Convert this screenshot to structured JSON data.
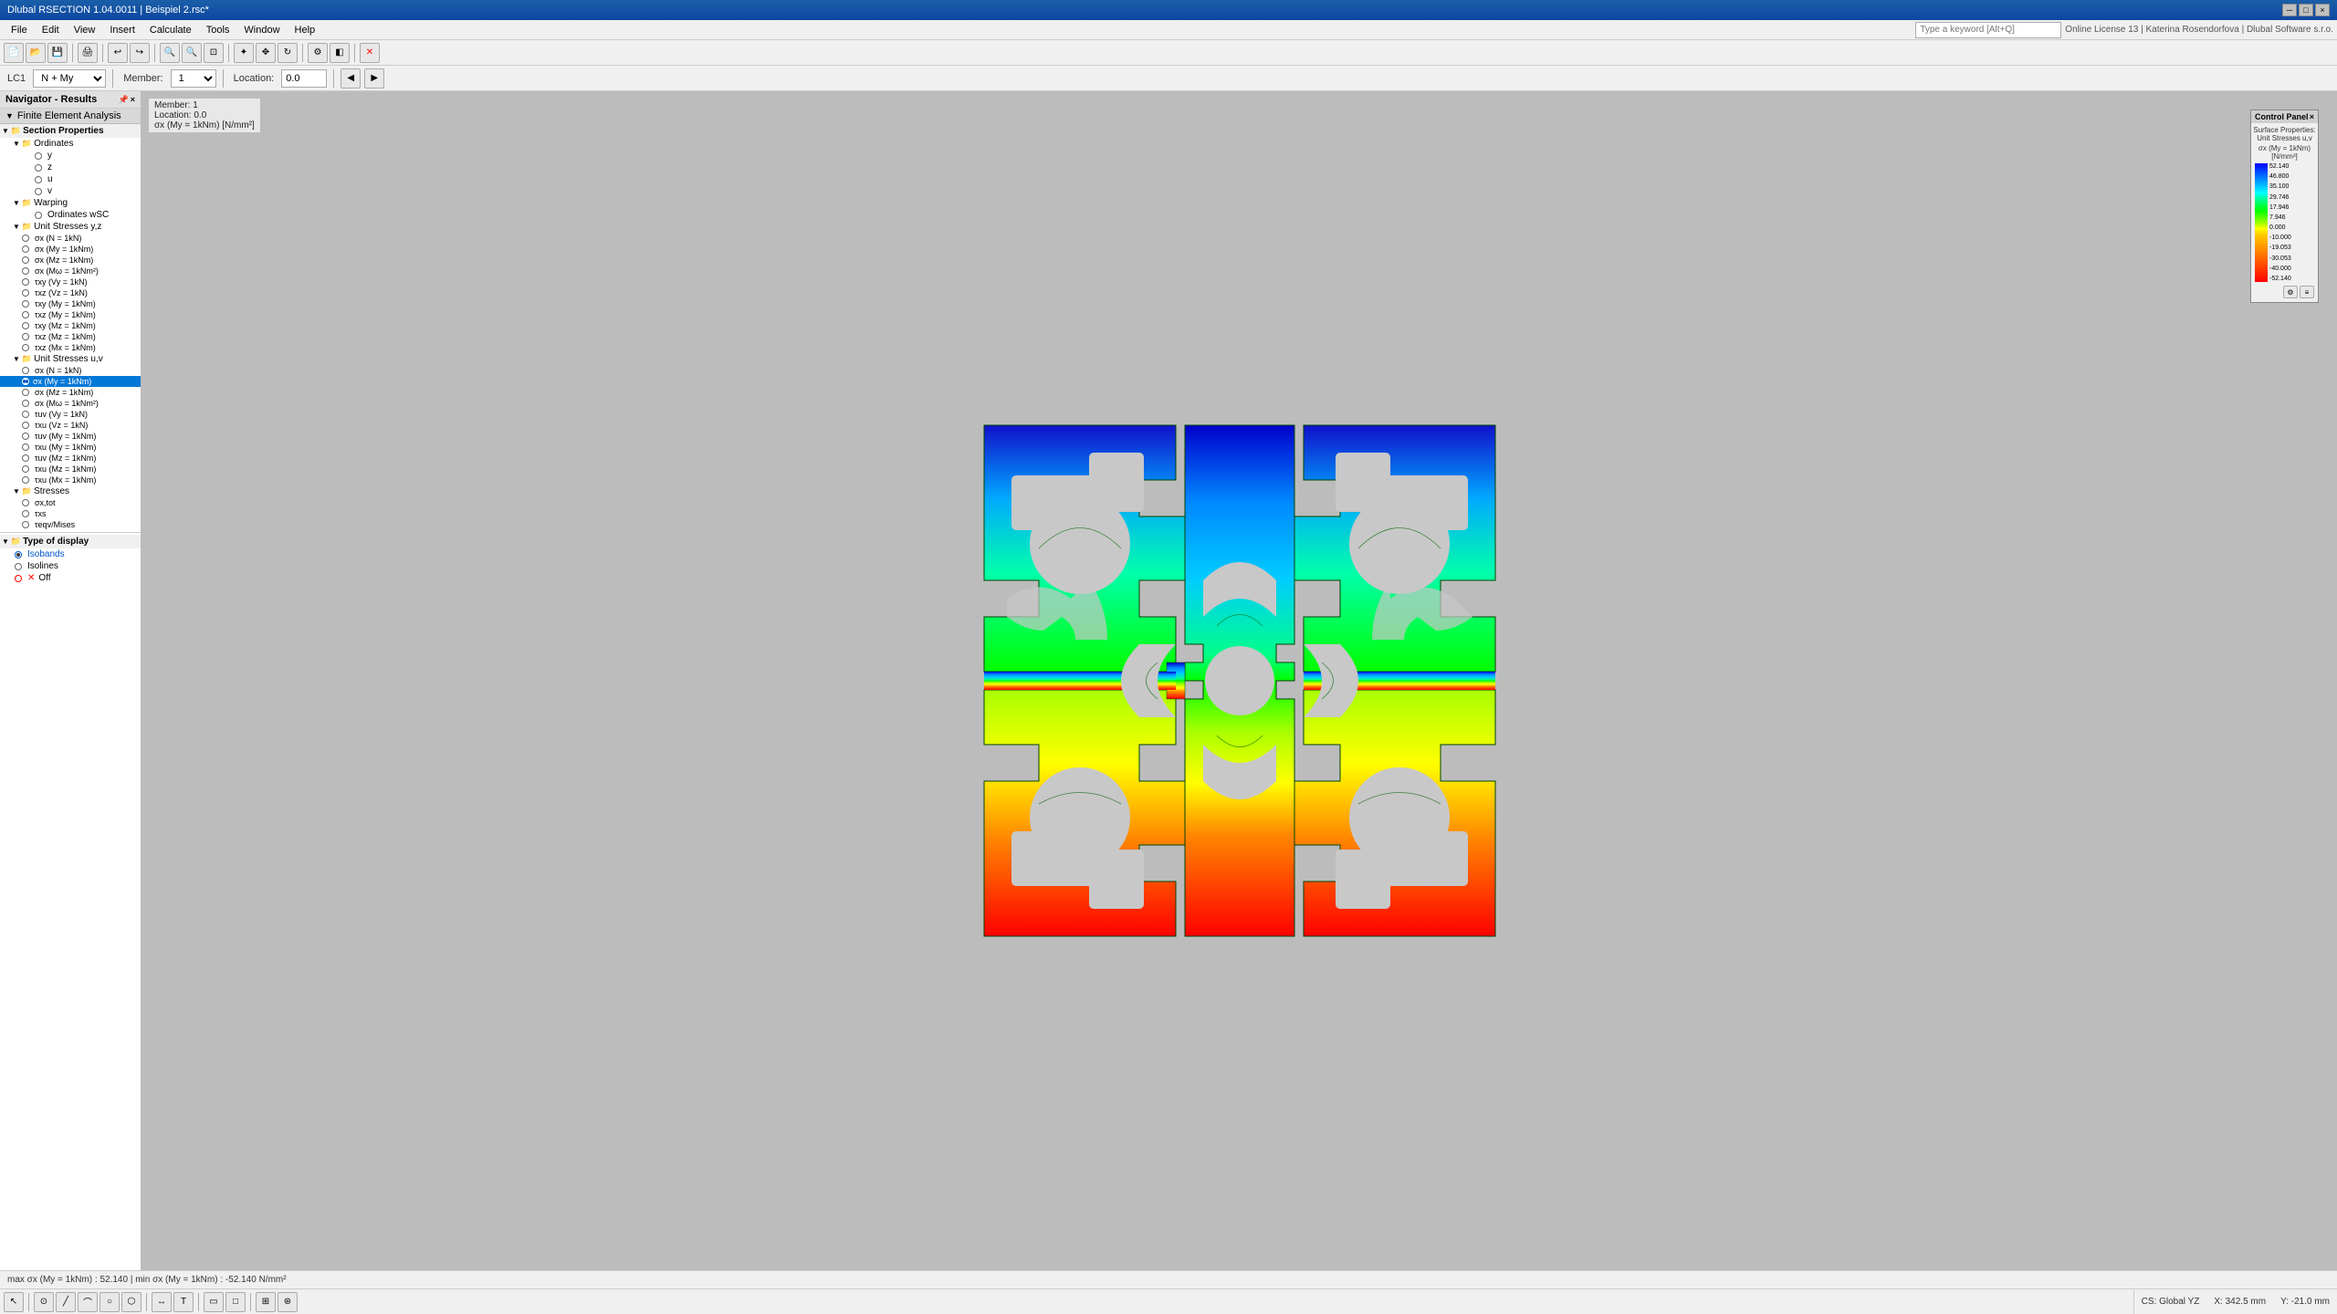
{
  "titleBar": {
    "title": "Dlubal RSECTION 1.04.0011 | Beispiel 2.rsc*",
    "controls": [
      "─",
      "□",
      "×"
    ]
  },
  "menuBar": {
    "items": [
      "File",
      "Edit",
      "View",
      "Insert",
      "Calculate",
      "Tools",
      "Window",
      "Help"
    ]
  },
  "toolbar1": {
    "buttons": [
      "new",
      "open",
      "save",
      "print",
      "undo",
      "redo",
      "zoom-in",
      "zoom-out",
      "zoom-fit"
    ]
  },
  "toolbar2": {
    "lc_label": "LC1",
    "lc_value": "N + My",
    "member_label": "Member:",
    "member_value": "1",
    "location_label": "Location:",
    "location_value": "0.0"
  },
  "navigator": {
    "title": "Navigator - Results",
    "fem_label": "Finite Element Analysis"
  },
  "tree": {
    "sections": [
      {
        "label": "Section Properties",
        "indent": 0,
        "type": "group",
        "expanded": true,
        "children": [
          {
            "label": "Ordinates",
            "indent": 1,
            "type": "group",
            "expanded": true,
            "children": [
              {
                "label": "y",
                "indent": 2,
                "type": "radio"
              },
              {
                "label": "z",
                "indent": 2,
                "type": "radio"
              },
              {
                "label": "u",
                "indent": 2,
                "type": "radio"
              },
              {
                "label": "v",
                "indent": 2,
                "type": "radio"
              }
            ]
          },
          {
            "label": "Warping",
            "indent": 1,
            "type": "group",
            "expanded": true,
            "children": [
              {
                "label": "Ordinates wSC",
                "indent": 2,
                "type": "radio"
              }
            ]
          },
          {
            "label": "Unit Stresses y,z",
            "indent": 1,
            "type": "group",
            "expanded": true,
            "children": [
              {
                "label": "σx (N = 1kN)",
                "indent": 2,
                "type": "radio"
              },
              {
                "label": "σx (My = 1kNm)",
                "indent": 2,
                "type": "radio"
              },
              {
                "label": "σx (Mz = 1kNm)",
                "indent": 2,
                "type": "radio"
              },
              {
                "label": "σx (Mω = 1kNm²)",
                "indent": 2,
                "type": "radio"
              },
              {
                "label": "τxy (Vy = 1kN)",
                "indent": 2,
                "type": "radio"
              },
              {
                "label": "τxz (Vz = 1kN)",
                "indent": 2,
                "type": "radio"
              },
              {
                "label": "τxy (My = 1kNm)",
                "indent": 2,
                "type": "radio"
              },
              {
                "label": "τxz (My = 1kNm)",
                "indent": 2,
                "type": "radio"
              },
              {
                "label": "τxy (Mz = 1kNm)",
                "indent": 2,
                "type": "radio"
              },
              {
                "label": "τxz (Mz = 1kNm)",
                "indent": 2,
                "type": "radio"
              },
              {
                "label": "τxz (Mx = 1kNm)",
                "indent": 2,
                "type": "radio"
              }
            ]
          },
          {
            "label": "Unit Stresses u,v",
            "indent": 1,
            "type": "group",
            "expanded": true,
            "children": [
              {
                "label": "σx (N = 1kN)",
                "indent": 2,
                "type": "radio"
              },
              {
                "label": "σx (My = 1kNm)",
                "indent": 2,
                "type": "radio",
                "selected": true
              },
              {
                "label": "σx (Mz = 1kNm)",
                "indent": 2,
                "type": "radio"
              },
              {
                "label": "σx (Mω = 1kNm²)",
                "indent": 2,
                "type": "radio"
              },
              {
                "label": "τuv (Vy = 1kN)",
                "indent": 2,
                "type": "radio"
              },
              {
                "label": "τxu (Vz = 1kN)",
                "indent": 2,
                "type": "radio"
              },
              {
                "label": "τuv (My = 1kNm)",
                "indent": 2,
                "type": "radio"
              },
              {
                "label": "τxu (My = 1kNm)",
                "indent": 2,
                "type": "radio"
              },
              {
                "label": "τuv (Mz = 1kNm)",
                "indent": 2,
                "type": "radio"
              },
              {
                "label": "τxu (Mz = 1kNm)",
                "indent": 2,
                "type": "radio"
              },
              {
                "label": "τxu (Mx = 1kNm)",
                "indent": 2,
                "type": "radio"
              }
            ]
          },
          {
            "label": "Stresses",
            "indent": 1,
            "type": "group",
            "expanded": true,
            "children": [
              {
                "label": "σx,tot",
                "indent": 2,
                "type": "radio"
              },
              {
                "label": "τxs",
                "indent": 2,
                "type": "radio"
              },
              {
                "label": "τeqv/Mises",
                "indent": 2,
                "type": "radio"
              }
            ]
          }
        ]
      },
      {
        "label": "Type of display",
        "indent": 0,
        "type": "group",
        "expanded": true,
        "children": [
          {
            "label": "Isobands",
            "indent": 1,
            "type": "radio",
            "active": true,
            "color": "blue"
          },
          {
            "label": "Isolines",
            "indent": 1,
            "type": "radio"
          },
          {
            "label": "Off",
            "indent": 1,
            "type": "radio",
            "cross": true
          }
        ]
      }
    ]
  },
  "infoPanel": {
    "member": "Member: 1",
    "location": "Location: 0.0",
    "formula": "σx (My = 1kNm) [N/mm²]"
  },
  "controlPanel": {
    "title": "Control Panel",
    "legendTitle": "Surface Properties: Unit Stresses u,v",
    "legendSubtitle": "σx (My = 1kNm) [N/mm²]",
    "values": [
      "52.140",
      "46.800",
      "35.100",
      "29.746",
      "17.946",
      "7.946",
      "0.000",
      "-10.000",
      "-19.053",
      "-30.053",
      "-40.000",
      "-52.140"
    ],
    "colors": {
      "top": "#0000cc",
      "bottom": "#cc0000"
    }
  },
  "statusBar": {
    "text": "max σx (My = 1kNm) : 52.140 | min σx (My = 1kNm) : -52.140 N/mm²"
  },
  "coordStatus": {
    "cs": "CS: Global YZ",
    "x": "X: 342.5 mm",
    "y": "Y: -21.0 mm"
  },
  "bottomToolbar": {
    "icons": [
      "pointer",
      "node",
      "line",
      "circle",
      "arc",
      "polygon",
      "dimension",
      "text"
    ]
  }
}
